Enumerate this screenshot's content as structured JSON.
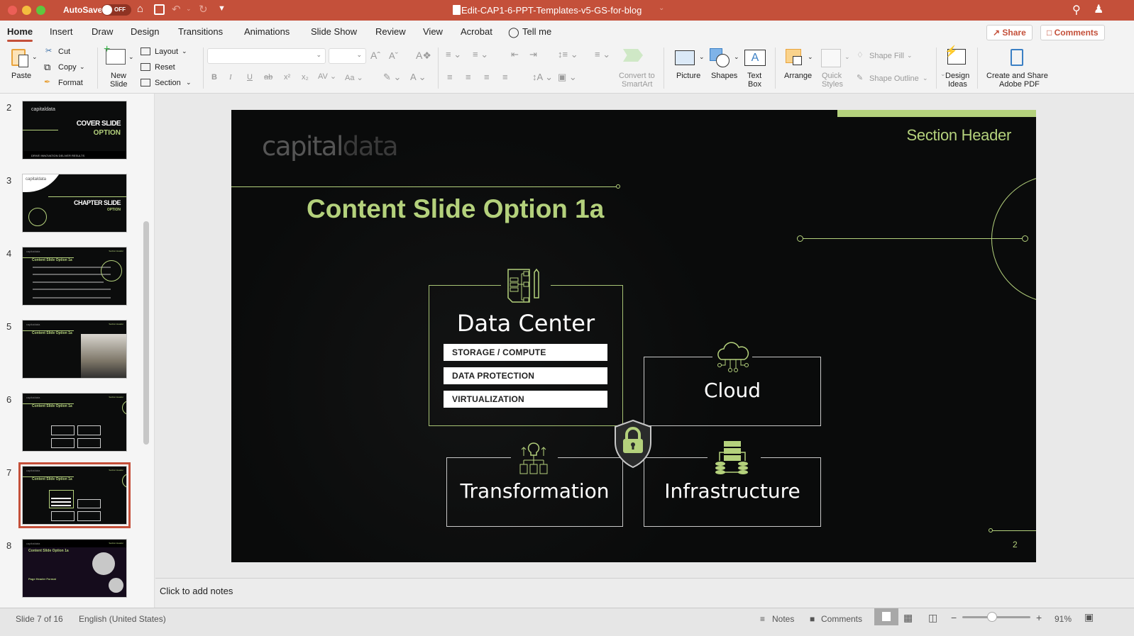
{
  "window": {
    "autosave_label": "AutoSave",
    "autosave_state": "OFF",
    "document_title": "Edit-CAP1-6-PPT-Templates-v5-GS-for-blog"
  },
  "tabs": [
    "Home",
    "Insert",
    "Draw",
    "Design",
    "Transitions",
    "Animations",
    "Slide Show",
    "Review",
    "View",
    "Acrobat"
  ],
  "tell_me": "Tell me",
  "share_label": "Share",
  "comments_label": "Comments",
  "ribbon": {
    "paste": "Paste",
    "cut": "Cut",
    "copy": "Copy",
    "format": "Format",
    "new_slide_1": "New",
    "new_slide_2": "Slide",
    "layout": "Layout",
    "reset": "Reset",
    "section": "Section",
    "font_name": "",
    "font_size": "",
    "convert_1": "Convert to",
    "convert_2": "SmartArt",
    "picture": "Picture",
    "shapes": "Shapes",
    "textbox_1": "Text",
    "textbox_2": "Box",
    "arrange": "Arrange",
    "quick_styles_1": "Quick",
    "quick_styles_2": "Styles",
    "shape_fill": "Shape Fill",
    "shape_outline": "Shape Outline",
    "design_ideas_1": "Design",
    "design_ideas_2": "Ideas",
    "adobe_1": "Create and Share",
    "adobe_2": "Adobe PDF"
  },
  "thumbnails": [
    {
      "num": "2",
      "title": "COVER SLIDE",
      "sub": "OPTION",
      "brand": "capitaldata",
      "footer": "DRIVE INNOVATION DELIVER RESULTS"
    },
    {
      "num": "3",
      "title": "CHAPTER SLIDE",
      "sub": "OPTION",
      "brand": "capitaldata"
    },
    {
      "num": "4",
      "title": "Content Slide Option 1a",
      "brand": "capitaldata",
      "header": "Section Header"
    },
    {
      "num": "5",
      "title": "Content Slide Option 1a",
      "brand": "capitaldata",
      "header": "Section Header"
    },
    {
      "num": "6",
      "title": "Content Slide Option 1a",
      "brand": "capitaldata",
      "header": "Section Header"
    },
    {
      "num": "7",
      "title": "Content Slide Option 1a",
      "brand": "capitaldata",
      "header": "Section Header"
    },
    {
      "num": "8",
      "title": "Content Slide Option 1a",
      "brand": "capitaldata",
      "header": "Section Header",
      "sub": "Page Header Format"
    }
  ],
  "slide": {
    "brand_a": "capital",
    "brand_b": "data",
    "section_header": "Section Header",
    "title": "Content Slide Option 1a",
    "page_number": "2",
    "data_center": {
      "label": "Data Center",
      "items": [
        "STORAGE / COMPUTE",
        "DATA PROTECTION",
        "VIRTUALIZATION"
      ]
    },
    "cloud": "Cloud",
    "transformation": "Transformation",
    "infrastructure": "Infrastructure",
    "accent_color": "#b4d17c"
  },
  "notes_placeholder": "Click to add notes",
  "status": {
    "slide_position": "Slide 7 of 16",
    "language": "English (United States)",
    "notes": "Notes",
    "comments": "Comments",
    "zoom_level": "91%",
    "zoom_slider_fraction": 0.44
  }
}
